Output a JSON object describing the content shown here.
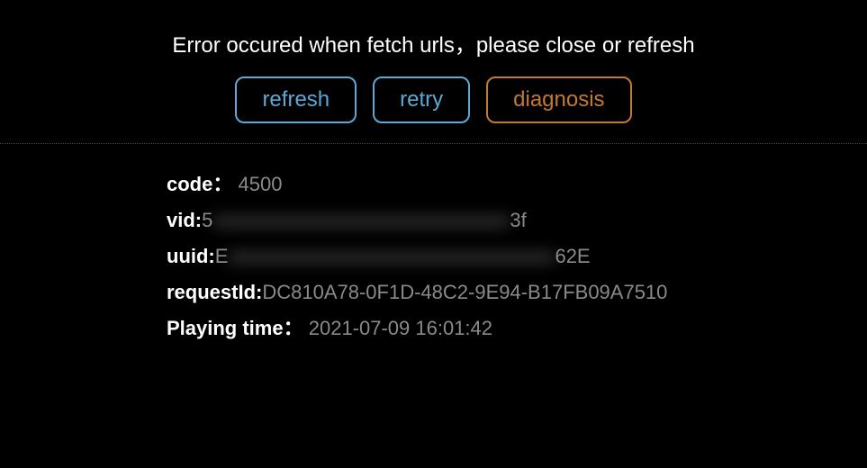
{
  "error_message": "Error occured when fetch urls，please close or refresh",
  "buttons": {
    "refresh": "refresh",
    "retry": "retry",
    "diagnosis": "diagnosis"
  },
  "details": {
    "code_label": "code：",
    "code_value": "4500",
    "vid_label": "vid:",
    "vid_prefix": "5",
    "vid_blurred": "xxxxxxxxxxxxxxxxxxxxxxxxxxxxxx",
    "vid_suffix": "3f",
    "uuid_label": "uuid:",
    "uuid_prefix": "E",
    "uuid_blurred": "xxxxxxxxxxxxxxxxxxxxxxxxxxxxxxxxx",
    "uuid_suffix": "62E",
    "requestid_label": "requestId:",
    "requestid_value": "DC810A78-0F1D-48C2-9E94-B17FB09A7510",
    "playingtime_label": "Playing time：",
    "playingtime_value": "2021-07-09 16:01:42"
  }
}
